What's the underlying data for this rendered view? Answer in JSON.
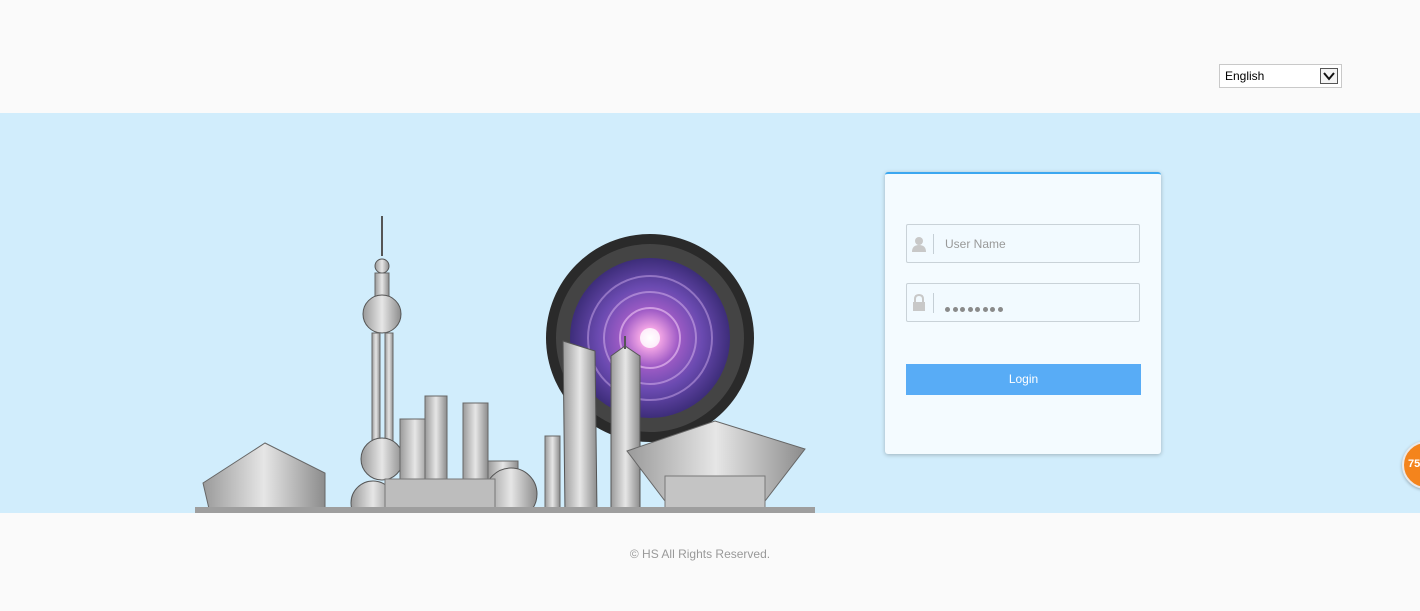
{
  "header": {
    "language": {
      "selected": "English"
    }
  },
  "login": {
    "username_placeholder": "User Name",
    "password_masked_length": 8,
    "login_label": "Login"
  },
  "footer": {
    "copyright": "©  HS  All Rights Reserved."
  },
  "badge": {
    "value": "75"
  },
  "colors": {
    "banner_bg": "#d1edfc",
    "accent": "#58acf6",
    "card_top_border": "#3ba7f0",
    "badge": "#f4841c"
  }
}
